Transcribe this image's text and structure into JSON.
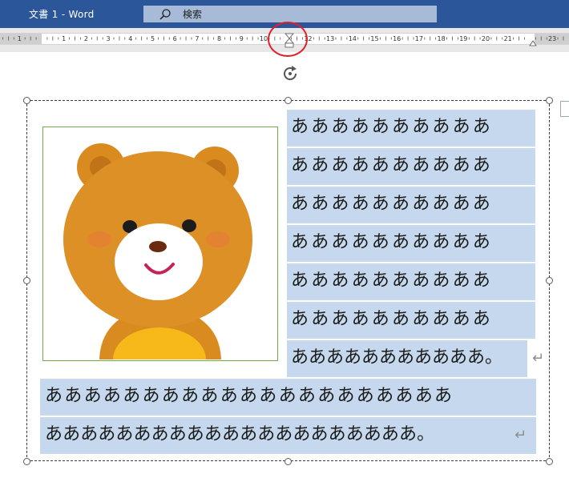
{
  "app": {
    "title": "文書 1  -  Word",
    "search_placeholder": "検索",
    "accent_color": "#2b579a"
  },
  "ruler": {
    "left_numbers": [
      "1",
      "1",
      "2",
      "3",
      "4",
      "5",
      "6",
      "7",
      "8",
      "9",
      "10"
    ],
    "right_numbers": [
      "12",
      "13",
      "14",
      "15",
      "16",
      "17",
      "18",
      "19",
      "20",
      "21",
      "23"
    ],
    "indent_marker_highlight_color": "#e01f26"
  },
  "picture": {
    "icon": "bear-illustration",
    "border_color": "#70ad47"
  },
  "document": {
    "highlight_color": "#c5d8ed",
    "lines": [
      "ああああああああああ",
      "ああああああああああ",
      "ああああああああああ",
      "ああああああああああ",
      "ああああああああああ",
      "ああああああああああ",
      "あああああああああああ。",
      "あああああああああああああああああああああ",
      "あああああああああああああああああああああ。"
    ],
    "paragraph_mark": "↵"
  }
}
